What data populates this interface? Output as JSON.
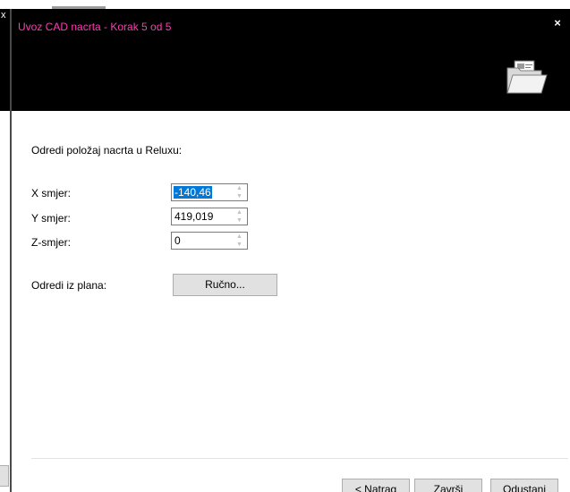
{
  "background_window": {
    "close_glyph": "x"
  },
  "dialog": {
    "title": "Uvoz CAD nacrta - Korak 5 od 5",
    "title_color": "#ff3cb4",
    "close_glyph": "×",
    "header_icon": "folder-icon",
    "instruction": "Odredi položaj nacrta u Reluxu:",
    "fields": [
      {
        "label": "X smjer:",
        "value": "-140,46",
        "selected": true
      },
      {
        "label": "Y smjer:",
        "value": "419,019",
        "selected": false
      },
      {
        "label": "Z-smjer:",
        "value": "0",
        "selected": false
      }
    ],
    "spin_up_glyph": "▲",
    "spin_down_glyph": "▼",
    "determine_label": "Odredi iz plana:",
    "determine_button": "Ručno...",
    "buttons": {
      "back": "< Natrag",
      "finish": "Završi",
      "cancel": "Odustani"
    }
  }
}
